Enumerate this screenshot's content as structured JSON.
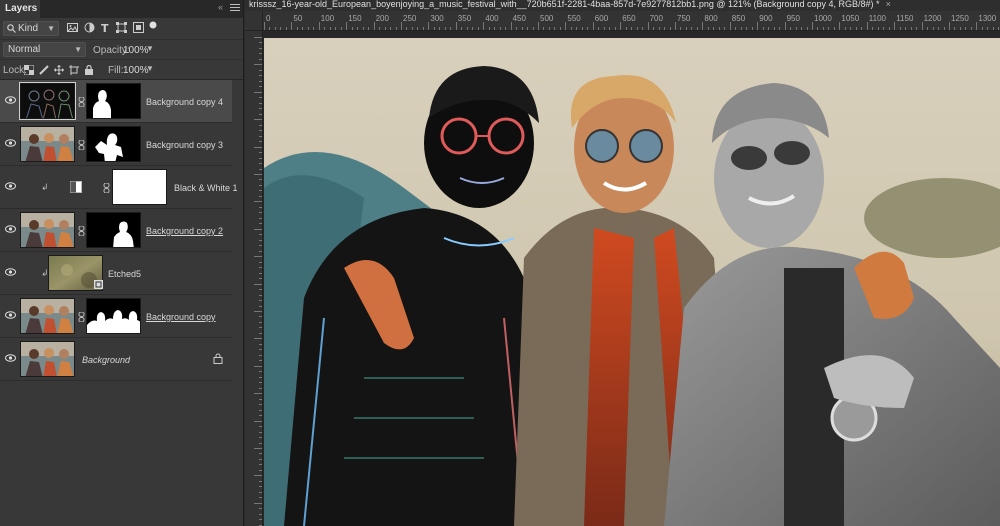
{
  "panel": {
    "tab_title": "Layers",
    "collapse_glyph": "«",
    "filter_kind": "Kind",
    "blend_mode": "Normal",
    "opacity_label": "Opacity:",
    "opacity_value": "100%",
    "lock_label": "Lock:",
    "fill_label": "Fill:",
    "fill_value": "100%"
  },
  "layers": [
    {
      "name": "Background copy 4",
      "selected": true,
      "style": "plain"
    },
    {
      "name": "Background copy 3",
      "selected": false,
      "style": "plain"
    },
    {
      "name": "Black & White 1",
      "selected": false,
      "style": "plain"
    },
    {
      "name": "Background copy 2",
      "selected": false,
      "style": "underline"
    },
    {
      "name": "Etched5",
      "selected": false,
      "style": "plain"
    },
    {
      "name": "Background copy ",
      "selected": false,
      "style": "underline"
    },
    {
      "name": "Background",
      "selected": false,
      "style": "italic"
    }
  ],
  "document": {
    "tab_title": "krisssz_16-year-old_European_boyenjoying_a_music_festival_with__720b651f-2281-4baa-857d-7e9277812bb1.png @ 121% (Background copy 4, RGB/8#) *",
    "close_glyph": "×",
    "ruler_labels": [
      "0",
      "50",
      "100",
      "150",
      "200",
      "250",
      "300",
      "350",
      "400",
      "450",
      "500",
      "550",
      "600",
      "650",
      "700",
      "750",
      "800",
      "850",
      "900",
      "950",
      "1000",
      "1050",
      "1100",
      "1150",
      "1200",
      "1250",
      "1300"
    ]
  },
  "icons": {
    "eye": "eye-icon",
    "chain": "link-icon",
    "lock": "lock-icon",
    "menu": "hamburger-menu-icon"
  },
  "colors": {
    "panel_bg": "#383838",
    "selected_row": "#4a4a4a",
    "canvas_bg": "#282828"
  }
}
